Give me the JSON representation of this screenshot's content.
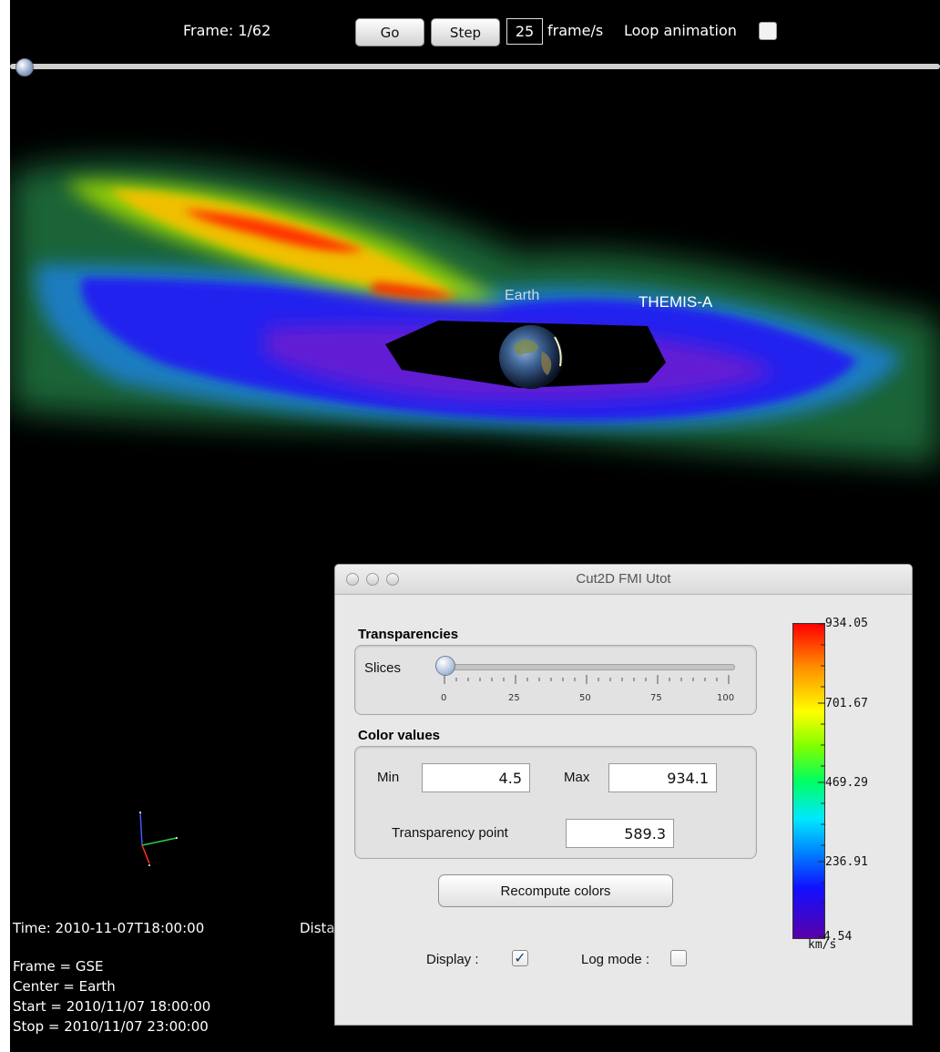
{
  "toolbar": {
    "frame_label": "Frame: 1/62",
    "go_label": "Go",
    "step_label": "Step",
    "fps_value": "25",
    "fps_unit": "frame/s",
    "loop_label": "Loop animation",
    "loop_checked": false,
    "frame_position": 0.0
  },
  "scene": {
    "earth_label": "Earth",
    "spacecraft_label": "THEMIS-A"
  },
  "info": {
    "time": "Time: 2010-11-07T18:00:00",
    "distance_partial": "Dista",
    "frame": "Frame = GSE",
    "center": "Center = Earth",
    "start": "Start = 2010/11/07 18:00:00",
    "stop": "Stop = 2010/11/07 23:00:00"
  },
  "panel": {
    "title": "Cut2D FMI  Utot",
    "transparencies_title": "Transparencies",
    "slices_label": "Slices",
    "slices_value": 0,
    "slider_ticks": [
      "0",
      "25",
      "50",
      "75",
      "100"
    ],
    "color_values_title": "Color values",
    "min_label": "Min",
    "min_value": "4.5",
    "max_label": "Max",
    "max_value": "934.1",
    "transparency_point_label": "Transparency point",
    "transparency_point_value": "589.3",
    "recompute_label": "Recompute colors",
    "display_label": "Display :",
    "display_checked": true,
    "log_mode_label": "Log mode :",
    "log_mode_checked": false
  },
  "colorbar": {
    "labels": [
      "934.05",
      "701.67",
      "469.29",
      "236.91",
      "4.54"
    ],
    "unit": "km/s",
    "colors": [
      "#5a00a8",
      "#1010ff",
      "#00e8ff",
      "#00ff60",
      "#ffff00",
      "#ff9000",
      "#ff0000"
    ]
  }
}
